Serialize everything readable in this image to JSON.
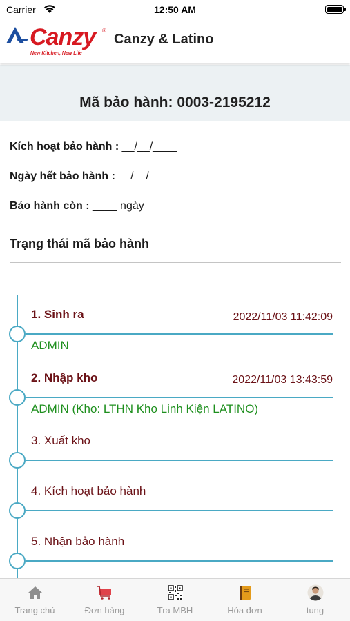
{
  "status_bar": {
    "carrier": "Carrier",
    "time": "12:50 AM"
  },
  "header": {
    "logo_text": "Canzy",
    "logo_tagline": "New Kitchen, New Life",
    "logo_reg": "®",
    "title": "Canzy & Latino",
    "brand_color": "#d71921"
  },
  "warranty": {
    "code_label": "Mã bảo hành: 0003-2195212",
    "activate_label": "Kích hoạt bảo hành :",
    "activate_value": "__/__/____",
    "expire_label": "Ngày hết bảo hành :",
    "expire_value": "__/__/____",
    "remaining_label": "Bảo hành còn :",
    "remaining_value": "____ ngày"
  },
  "status_section": {
    "title": "Trạng thái mã bảo hành",
    "steps": [
      {
        "title": "1. Sinh ra",
        "time": "2022/11/03 11:42:09",
        "actor": "ADMIN",
        "done": true
      },
      {
        "title": "2. Nhập kho",
        "time": "2022/11/03 13:43:59",
        "actor": "ADMIN (Kho: LTHN Kho Linh Kiện LATINO)",
        "done": true
      },
      {
        "title": "3. Xuất kho",
        "time": "",
        "actor": "",
        "done": false
      },
      {
        "title": "4. Kích hoạt bảo hành",
        "time": "",
        "actor": "",
        "done": false
      },
      {
        "title": "5. Nhận bảo hành",
        "time": "",
        "actor": "",
        "done": false
      }
    ],
    "line_color": "#4aa9c4",
    "title_color": "#6b1217",
    "actor_color": "#1e8f1e"
  },
  "tabs": [
    {
      "label": "Trang chủ",
      "icon": "home-icon"
    },
    {
      "label": "Đơn hàng",
      "icon": "cart-icon"
    },
    {
      "label": "Tra MBH",
      "icon": "qr-code-icon"
    },
    {
      "label": "Hóa đơn",
      "icon": "invoice-book-icon"
    },
    {
      "label": "tung",
      "icon": "user-avatar-icon"
    }
  ]
}
